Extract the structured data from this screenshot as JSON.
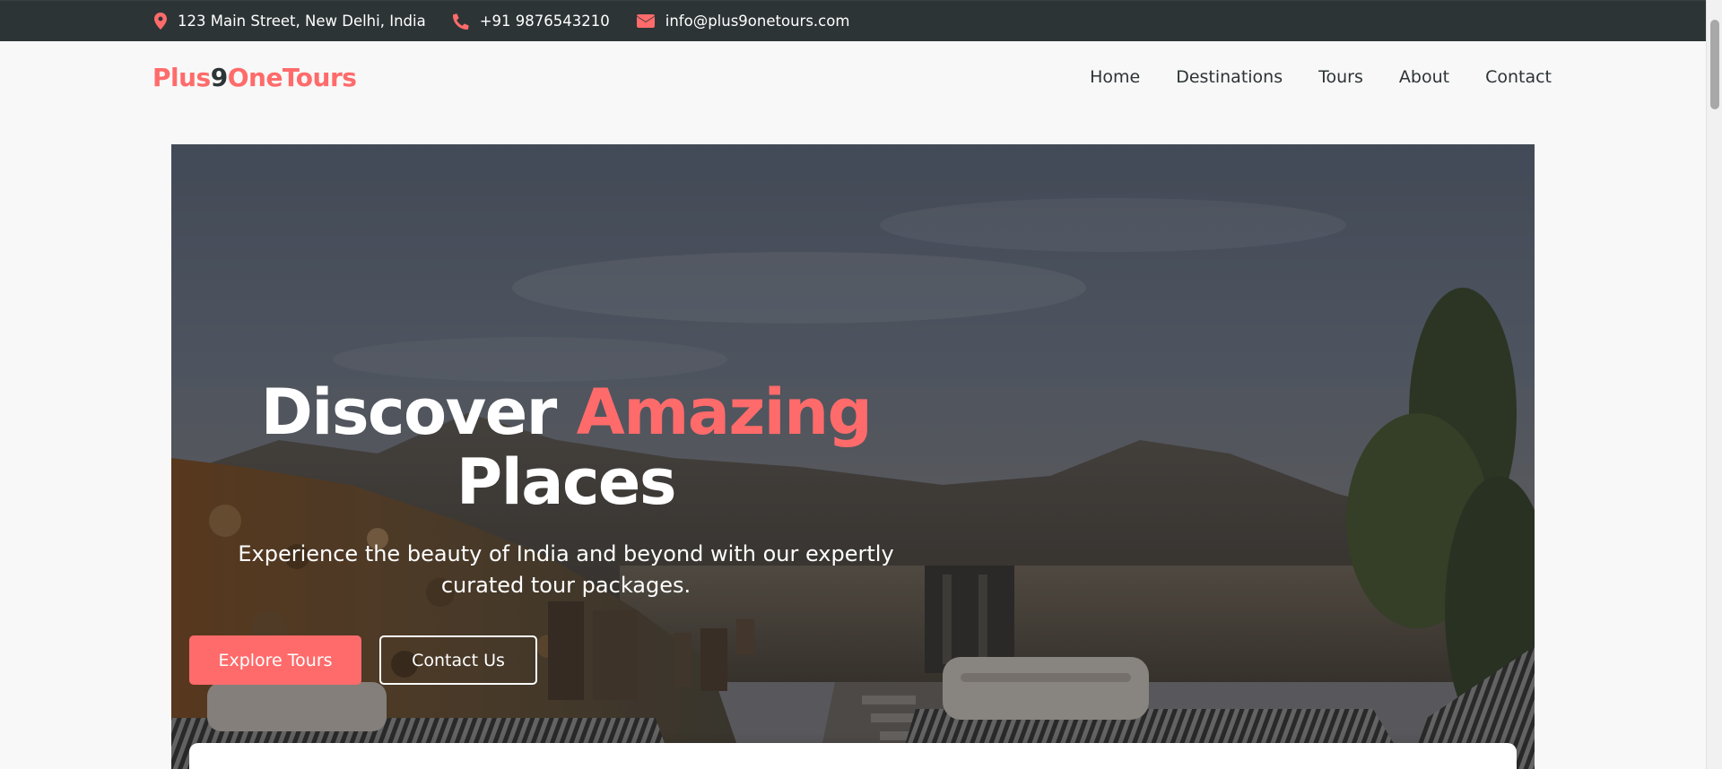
{
  "topbar": {
    "address": "123 Main Street, New Delhi, India",
    "phone": "+91 9876543210",
    "email": "info@plus9onetours.com",
    "address_icon": "map-pin-icon",
    "phone_icon": "phone-icon",
    "email_icon": "envelope-icon"
  },
  "logo": {
    "part1": "Plus",
    "part2": "9",
    "part3": "OneTours"
  },
  "nav": {
    "items": [
      "Home",
      "Destinations",
      "Tours",
      "About",
      "Contact"
    ]
  },
  "hero": {
    "title_part1": "Discover ",
    "title_accent": "Amazing",
    "title_part2": "Places",
    "subtitle": "Experience the beauty of India and beyond with our expertly curated tour packages.",
    "primary_button": "Explore Tours",
    "secondary_button": "Contact Us"
  },
  "colors": {
    "accent": "#ff6b6b",
    "dark": "#2d3436",
    "background": "#f8f8f8"
  }
}
